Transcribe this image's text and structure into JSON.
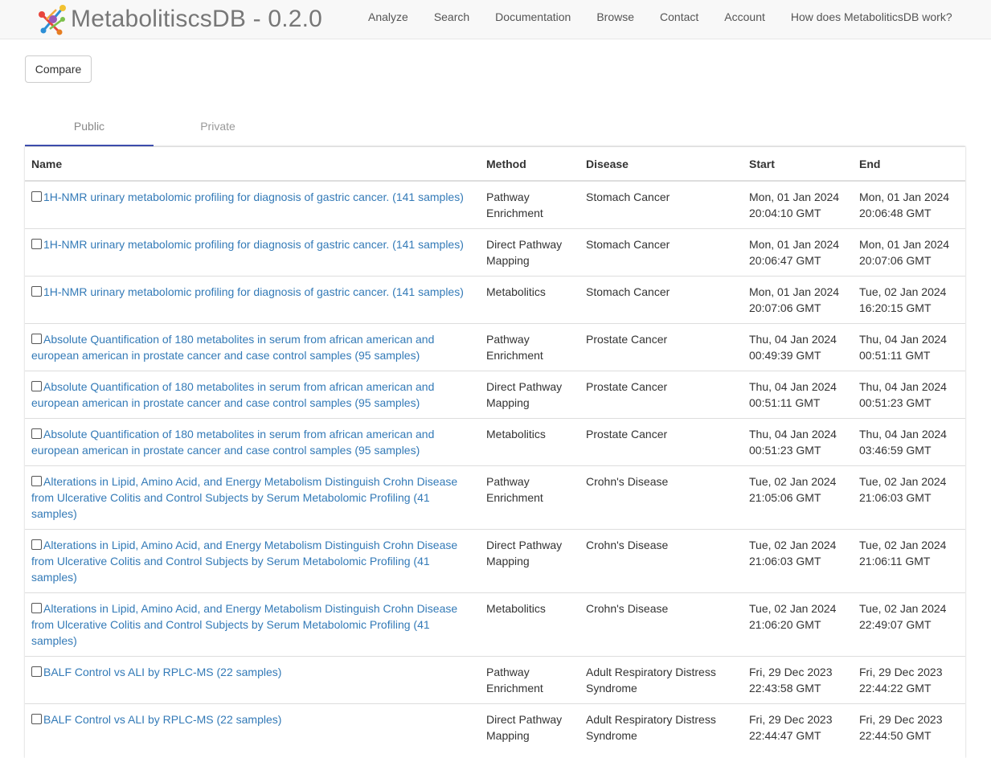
{
  "app": {
    "brand": "MetabolitiscsDB - 0.2.0",
    "nav": [
      "Analyze",
      "Search",
      "Documentation",
      "Browse",
      "Contact",
      "Account",
      "How does MetaboliticsDB work?"
    ]
  },
  "toolbar": {
    "compare_label": "Compare"
  },
  "tabs": [
    {
      "label": "Public",
      "active": true
    },
    {
      "label": "Private",
      "active": false
    }
  ],
  "table": {
    "headers": [
      "Name",
      "Method",
      "Disease",
      "Start",
      "End"
    ],
    "rows": [
      {
        "name": "1H-NMR urinary metabolomic profiling for diagnosis of gastric cancer. (141 samples)",
        "method": "Pathway Enrichment",
        "disease": "Stomach Cancer",
        "start": "Mon, 01 Jan 2024 20:04:10 GMT",
        "end": "Mon, 01 Jan 2024 20:06:48 GMT"
      },
      {
        "name": "1H-NMR urinary metabolomic profiling for diagnosis of gastric cancer. (141 samples)",
        "method": "Direct Pathway Mapping",
        "disease": "Stomach Cancer",
        "start": "Mon, 01 Jan 2024 20:06:47 GMT",
        "end": "Mon, 01 Jan 2024 20:07:06 GMT"
      },
      {
        "name": "1H-NMR urinary metabolomic profiling for diagnosis of gastric cancer. (141 samples)",
        "method": "Metabolitics",
        "disease": "Stomach Cancer",
        "start": "Mon, 01 Jan 2024 20:07:06 GMT",
        "end": "Tue, 02 Jan 2024 16:20:15 GMT"
      },
      {
        "name": "Absolute Quantification of 180 metabolites in serum from african american and european american in prostate cancer and case control samples (95 samples)",
        "method": "Pathway Enrichment",
        "disease": "Prostate Cancer",
        "start": "Thu, 04 Jan 2024 00:49:39 GMT",
        "end": "Thu, 04 Jan 2024 00:51:11 GMT"
      },
      {
        "name": "Absolute Quantification of 180 metabolites in serum from african american and european american in prostate cancer and case control samples (95 samples)",
        "method": "Direct Pathway Mapping",
        "disease": "Prostate Cancer",
        "start": "Thu, 04 Jan 2024 00:51:11 GMT",
        "end": "Thu, 04 Jan 2024 00:51:23 GMT"
      },
      {
        "name": "Absolute Quantification of 180 metabolites in serum from african american and european american in prostate cancer and case control samples (95 samples)",
        "method": "Metabolitics",
        "disease": "Prostate Cancer",
        "start": "Thu, 04 Jan 2024 00:51:23 GMT",
        "end": "Thu, 04 Jan 2024 03:46:59 GMT"
      },
      {
        "name": "Alterations in Lipid, Amino Acid, and Energy Metabolism Distinguish Crohn Disease from Ulcerative Colitis and Control Subjects by Serum Metabolomic Profiling (41 samples)",
        "method": "Pathway Enrichment",
        "disease": "Crohn's Disease",
        "start": "Tue, 02 Jan 2024 21:05:06 GMT",
        "end": "Tue, 02 Jan 2024 21:06:03 GMT"
      },
      {
        "name": "Alterations in Lipid, Amino Acid, and Energy Metabolism Distinguish Crohn Disease from Ulcerative Colitis and Control Subjects by Serum Metabolomic Profiling (41 samples)",
        "method": "Direct Pathway Mapping",
        "disease": "Crohn's Disease",
        "start": "Tue, 02 Jan 2024 21:06:03 GMT",
        "end": "Tue, 02 Jan 2024 21:06:11 GMT"
      },
      {
        "name": "Alterations in Lipid, Amino Acid, and Energy Metabolism Distinguish Crohn Disease from Ulcerative Colitis and Control Subjects by Serum Metabolomic Profiling (41 samples)",
        "method": "Metabolitics",
        "disease": "Crohn's Disease",
        "start": "Tue, 02 Jan 2024 21:06:20 GMT",
        "end": "Tue, 02 Jan 2024 22:49:07 GMT"
      },
      {
        "name": "BALF Control vs ALI by RPLC-MS (22 samples)",
        "method": "Pathway Enrichment",
        "disease": "Adult Respiratory Distress Syndrome",
        "start": "Fri, 29 Dec 2023 22:43:58 GMT",
        "end": "Fri, 29 Dec 2023 22:44:22 GMT"
      },
      {
        "name": "BALF Control vs ALI by RPLC-MS (22 samples)",
        "method": "Direct Pathway Mapping",
        "disease": "Adult Respiratory Distress Syndrome",
        "start": "Fri, 29 Dec 2023 22:44:47 GMT",
        "end": "Fri, 29 Dec 2023 22:44:50 GMT"
      }
    ]
  }
}
